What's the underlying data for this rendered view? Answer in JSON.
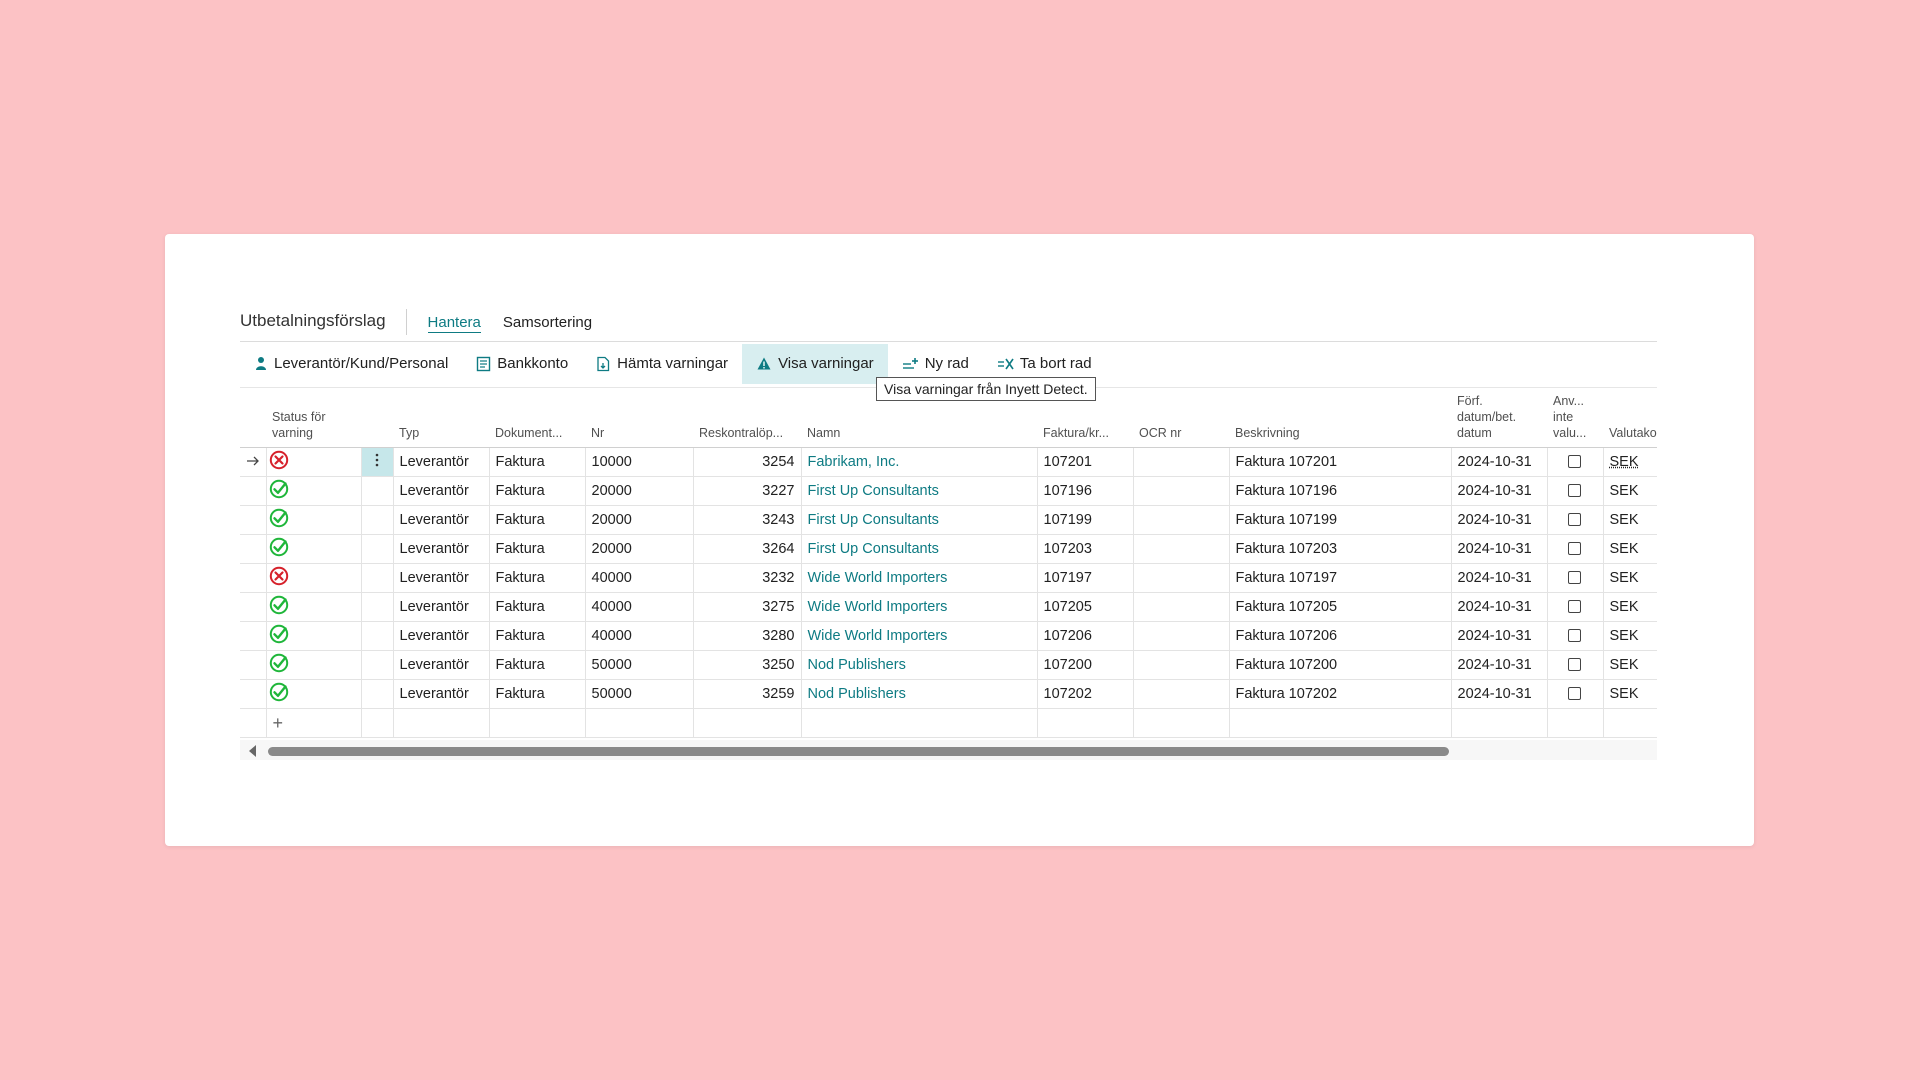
{
  "header": {
    "title": "Utbetalningsförslag",
    "tabs": [
      {
        "label": "Hantera",
        "active": true
      },
      {
        "label": "Samsortering",
        "active": false
      }
    ]
  },
  "toolbar": {
    "buttons": [
      {
        "label": "Leverantör/Kund/Personal",
        "icon": "person-icon"
      },
      {
        "label": "Bankkonto",
        "icon": "bank-account-icon"
      },
      {
        "label": "Hämta varningar",
        "icon": "fetch-document-icon"
      },
      {
        "label": "Visa varningar",
        "icon": "show-warnings-icon",
        "active": true
      },
      {
        "label": "Ny rad",
        "icon": "new-line-icon"
      },
      {
        "label": "Ta bort rad",
        "icon": "delete-line-icon"
      }
    ],
    "tooltip": "Visa varningar från Inyett Detect."
  },
  "table": {
    "headers": {
      "status_line1": "Status för",
      "status_line2": "varning",
      "typ": "Typ",
      "dokument": "Dokument...",
      "nr": "Nr",
      "reskontra": "Reskontralöp...",
      "namn": "Namn",
      "faktura": "Faktura/kr...",
      "ocr": "OCR nr",
      "beskrivning": "Beskrivning",
      "forf_line1": "Förf.",
      "forf_line2": "datum/bet.",
      "forf_line3": "datum",
      "anv_line1": "Anv...",
      "anv_line2": "inte",
      "anv_line3": "valu...",
      "valutakod": "Valutakod"
    },
    "rows": [
      {
        "status": "error",
        "typ": "Leverantör",
        "dokument": "Faktura",
        "nr": "10000",
        "reskontra": "3254",
        "namn": "Fabrikam, Inc.",
        "faktura": "107201",
        "ocr": "",
        "beskrivning": "Faktura 107201",
        "datum": "2024-10-31",
        "valuta": "SEK",
        "current": true
      },
      {
        "status": "ok",
        "typ": "Leverantör",
        "dokument": "Faktura",
        "nr": "20000",
        "reskontra": "3227",
        "namn": "First Up Consultants",
        "faktura": "107196",
        "ocr": "",
        "beskrivning": "Faktura 107196",
        "datum": "2024-10-31",
        "valuta": "SEK"
      },
      {
        "status": "ok",
        "typ": "Leverantör",
        "dokument": "Faktura",
        "nr": "20000",
        "reskontra": "3243",
        "namn": "First Up Consultants",
        "faktura": "107199",
        "ocr": "",
        "beskrivning": "Faktura 107199",
        "datum": "2024-10-31",
        "valuta": "SEK"
      },
      {
        "status": "ok",
        "typ": "Leverantör",
        "dokument": "Faktura",
        "nr": "20000",
        "reskontra": "3264",
        "namn": "First Up Consultants",
        "faktura": "107203",
        "ocr": "",
        "beskrivning": "Faktura 107203",
        "datum": "2024-10-31",
        "valuta": "SEK"
      },
      {
        "status": "error",
        "typ": "Leverantör",
        "dokument": "Faktura",
        "nr": "40000",
        "reskontra": "3232",
        "namn": "Wide World Importers",
        "faktura": "107197",
        "ocr": "",
        "beskrivning": "Faktura 107197",
        "datum": "2024-10-31",
        "valuta": "SEK"
      },
      {
        "status": "ok",
        "typ": "Leverantör",
        "dokument": "Faktura",
        "nr": "40000",
        "reskontra": "3275",
        "namn": "Wide World Importers",
        "faktura": "107205",
        "ocr": "",
        "beskrivning": "Faktura 107205",
        "datum": "2024-10-31",
        "valuta": "SEK"
      },
      {
        "status": "ok",
        "typ": "Leverantör",
        "dokument": "Faktura",
        "nr": "40000",
        "reskontra": "3280",
        "namn": "Wide World Importers",
        "faktura": "107206",
        "ocr": "",
        "beskrivning": "Faktura 107206",
        "datum": "2024-10-31",
        "valuta": "SEK"
      },
      {
        "status": "ok",
        "typ": "Leverantör",
        "dokument": "Faktura",
        "nr": "50000",
        "reskontra": "3250",
        "namn": "Nod Publishers",
        "faktura": "107200",
        "ocr": "",
        "beskrivning": "Faktura 107200",
        "datum": "2024-10-31",
        "valuta": "SEK"
      },
      {
        "status": "ok",
        "typ": "Leverantör",
        "dokument": "Faktura",
        "nr": "50000",
        "reskontra": "3259",
        "namn": "Nod Publishers",
        "faktura": "107202",
        "ocr": "",
        "beskrivning": "Faktura 107202",
        "datum": "2024-10-31",
        "valuta": "SEK"
      }
    ],
    "new_row_symbol": "+"
  },
  "colors": {
    "accent": "#0e7b83",
    "ok": "#1fb63a",
    "error": "#d6212b",
    "background": "#fcc2c5"
  }
}
